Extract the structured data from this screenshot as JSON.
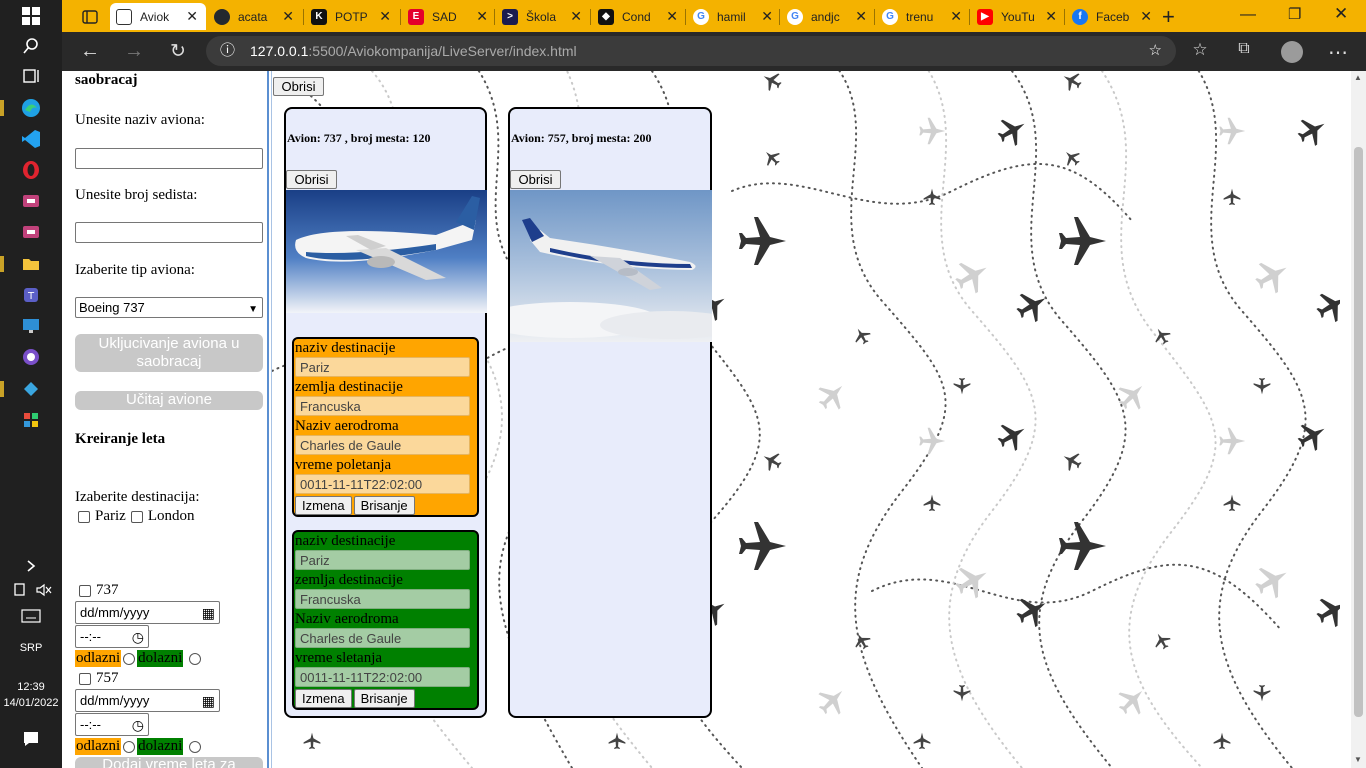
{
  "taskbar": {
    "time": "12:39",
    "date": "14/01/2022",
    "language": "SRP"
  },
  "browser": {
    "tabs": [
      {
        "title": "Aviok",
        "icon": "page-icon",
        "color": "#ffffff"
      },
      {
        "title": "acata",
        "icon": "github-icon",
        "color": "#24292e"
      },
      {
        "title": "POTP",
        "icon": "k-icon",
        "color": "#111111"
      },
      {
        "title": "SAD",
        "icon": "e-icon",
        "color": "#e4002b"
      },
      {
        "title": "Škola",
        "icon": "chevron-icon",
        "color": "#1b1b4f"
      },
      {
        "title": "Cond",
        "icon": "codewars-icon",
        "color": "#111111"
      },
      {
        "title": "hamil",
        "icon": "google-icon",
        "color": "#ffffff"
      },
      {
        "title": "andjc",
        "icon": "google-icon",
        "color": "#ffffff"
      },
      {
        "title": "trenu",
        "icon": "google-icon",
        "color": "#ffffff"
      },
      {
        "title": "YouTu",
        "icon": "youtube-icon",
        "color": "#ff0000"
      },
      {
        "title": "Faceb",
        "icon": "facebook-icon",
        "color": "#1877f2"
      }
    ],
    "url_host": "127.0.0.1",
    "url_path": ":5500/Aviokompanija/LiveServer/index.html"
  },
  "form": {
    "section1_title": "saobracaj",
    "name_label": "Unesite naziv aviona:",
    "seats_label": "Unesite broj sedista:",
    "type_label": "Izaberite tip aviona:",
    "type_selected": "Boeing 737",
    "include_button": "Uklјucivanje aviona u saobracaj",
    "load_button": "Učitaj avione",
    "section2_title": "Kreiranje leta",
    "destination_label": "Izaberite destinacija:",
    "destinations": [
      "Pariz",
      "London"
    ],
    "plane_options": [
      {
        "label": "737",
        "date_placeholder": "dd/mm/yyyy",
        "time_placeholder": "--:--",
        "dep_label": "odlazni",
        "arr_label": "dolazni"
      },
      {
        "label": "757",
        "date_placeholder": "dd/mm/yyyy",
        "time_placeholder": "--:--",
        "dep_label": "odlazni",
        "arr_label": "dolazni"
      }
    ],
    "add_time_button": "Dodaj vreme leta za"
  },
  "top_delete_button": "Obrisi",
  "planes": [
    {
      "title": "Avion: 737 , broj mesta: 120",
      "delete_label": "Obrisi",
      "flights": [
        {
          "style": "orange",
          "color": "#ffa500",
          "dest_label": "naziv destinacije",
          "dest_value": "Pariz",
          "country_label": "zemlja destinacije",
          "country_value": "Francuska",
          "airport_label": "Naziv aerodroma",
          "airport_value": "Charles de Gaule",
          "time_label": "vreme poletanja",
          "time_value": "0011-11-11T22:02:00",
          "edit_label": "Izmena",
          "delete_label": "Brisanje"
        },
        {
          "style": "green",
          "color": "#008000",
          "dest_label": "naziv destinacije",
          "dest_value": "Pariz",
          "country_label": "zemlja destinacije",
          "country_value": "Francuska",
          "airport_label": "Naziv aerodroma",
          "airport_value": "Charles de Gaule",
          "time_label": "vreme sletanja",
          "time_value": "0011-11-11T22:02:00",
          "edit_label": "Izmena",
          "delete_label": "Brisanje"
        }
      ]
    },
    {
      "title": "Avion: 757, broj mesta: 200",
      "delete_label": "Obrisi",
      "flights": []
    }
  ]
}
